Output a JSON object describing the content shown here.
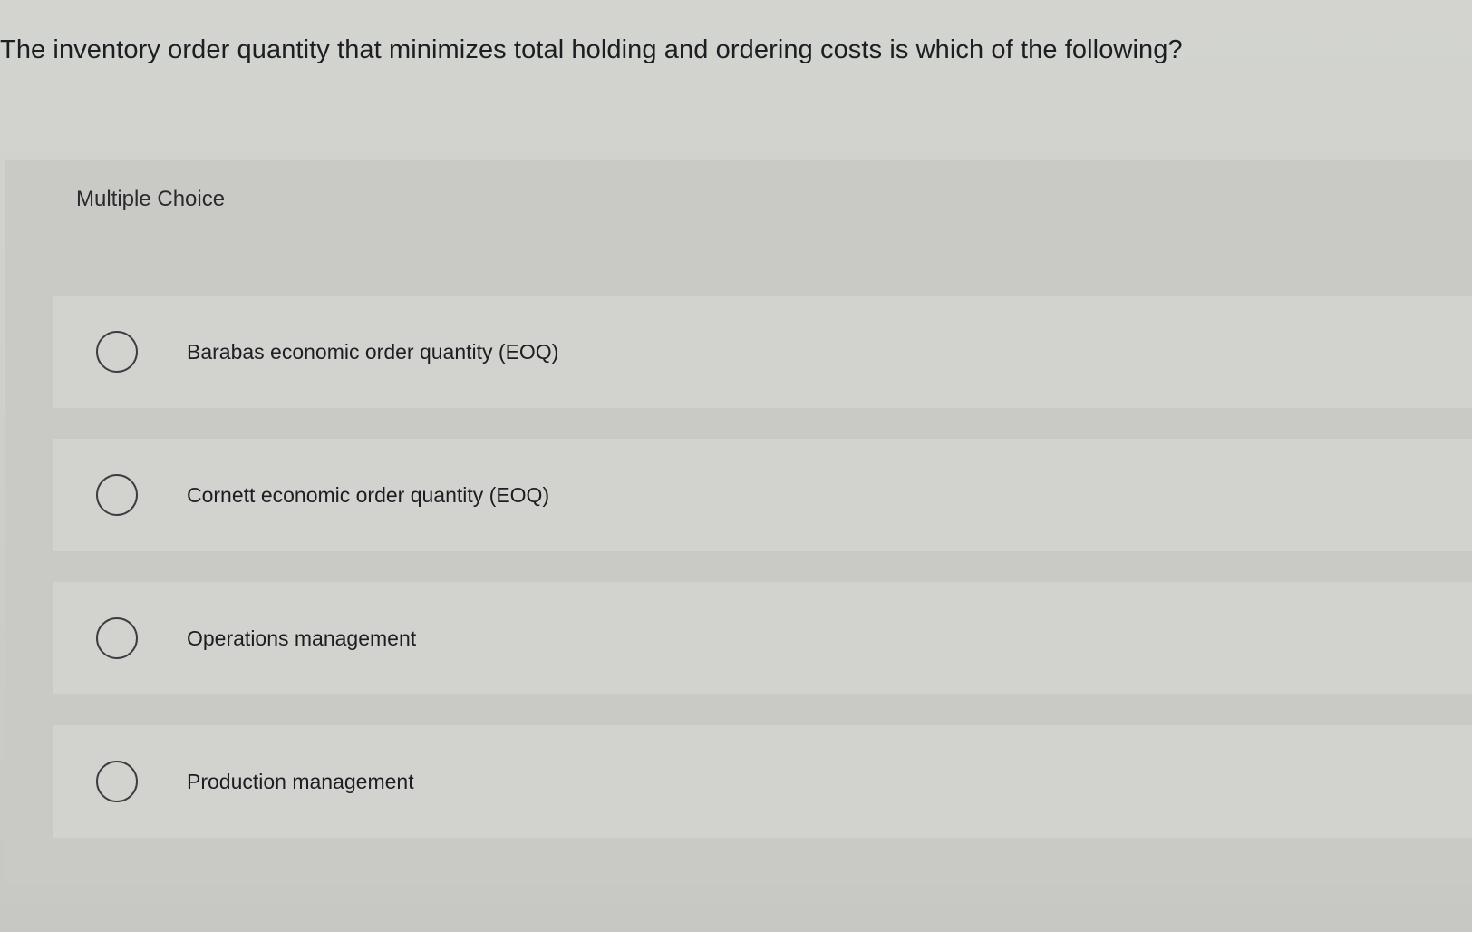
{
  "question": {
    "text": "The inventory order quantity that minimizes total holding and ordering costs is which of the following?"
  },
  "section": {
    "label": "Multiple Choice"
  },
  "options": [
    {
      "label": "Barabas economic order quantity (EOQ)",
      "selected": false
    },
    {
      "label": "Cornett economic order quantity (EOQ)",
      "selected": false
    },
    {
      "label": "Operations management",
      "selected": false
    },
    {
      "label": "Production management",
      "selected": false
    }
  ]
}
